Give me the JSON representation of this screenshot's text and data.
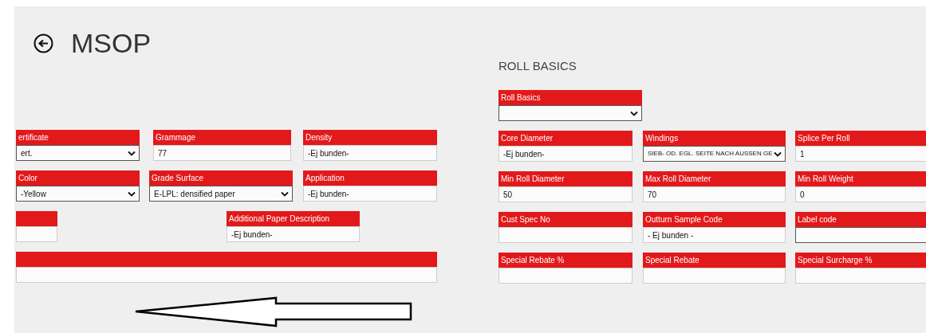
{
  "header": {
    "title": "MSOP"
  },
  "left_panel": {
    "rows": [
      [
        {
          "label": "ertificate",
          "kind": "select",
          "value": "ert.",
          "focused": true
        },
        {
          "label": "Grammage",
          "kind": "text",
          "value": "77",
          "focused": false
        },
        {
          "label": "Density",
          "kind": "text",
          "value": "-Ej bunden-",
          "focused": false
        }
      ],
      [
        {
          "label": "Color",
          "kind": "select",
          "value": "-Yellow",
          "focused": true
        },
        {
          "label": "Grade Surface",
          "kind": "select",
          "value": "E-LPL: densified paper",
          "focused": true
        },
        {
          "label": "Application",
          "kind": "text",
          "value": "-Ej bunden-",
          "focused": false
        }
      ],
      [
        {
          "kind": "text",
          "focused": false
        },
        {
          "label": "Additional Paper Description",
          "kind": "text",
          "value": "-Ej bunden-",
          "focused": false
        }
      ],
      [
        {
          "kind": "text",
          "focused": false
        }
      ]
    ]
  },
  "roll_basics": {
    "heading": "ROLL BASICS",
    "selector": {
      "label": "Roll Basics",
      "kind": "select",
      "focused": true
    },
    "rows": [
      [
        {
          "label": "Core Diameter",
          "kind": "text",
          "value": "-Ej bunden-",
          "focused": false
        },
        {
          "label": "Windings",
          "kind": "select",
          "value": "SIEB- OD. EGL. SEITE NACH AUSSEN GE",
          "focused": true
        },
        {
          "label": "Splice Per Roll",
          "kind": "text",
          "value": "1",
          "focused": false
        }
      ],
      [
        {
          "label": "Min Roll Diameter",
          "kind": "text",
          "value": "50",
          "focused": false
        },
        {
          "label": "Max Roll Diameter",
          "kind": "text",
          "value": "70",
          "focused": false
        },
        {
          "label": "Min Roll Weight",
          "kind": "text",
          "value": "0",
          "focused": false
        }
      ],
      [
        {
          "label": "Cust Spec No",
          "kind": "text",
          "focused": false
        },
        {
          "label": "Outturn Sample Code",
          "kind": "text",
          "value": "- Ej bunden -",
          "focused": false
        },
        {
          "label": "Label code",
          "kind": "text",
          "focused": true
        }
      ],
      [
        {
          "label": "Special Rebate %",
          "kind": "text",
          "focused": false
        },
        {
          "label": "Special Rebate",
          "kind": "text",
          "focused": false
        },
        {
          "label": "Special Surcharge %",
          "kind": "text",
          "focused": false
        }
      ]
    ]
  }
}
